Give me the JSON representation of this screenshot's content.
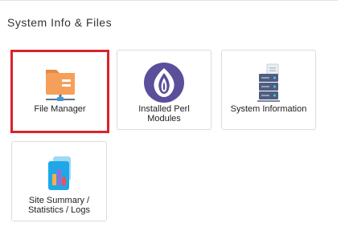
{
  "section": {
    "title": "System Info & Files"
  },
  "tiles": [
    {
      "label": "File Manager",
      "icon": "folder-network-icon",
      "selected": true
    },
    {
      "label": "Installed Perl Modules",
      "icon": "perl-onion-icon",
      "selected": false
    },
    {
      "label": "System Information",
      "icon": "server-rack-icon",
      "selected": false
    },
    {
      "label": "Site Summary / Statistics / Logs",
      "icon": "statistics-document-icon",
      "selected": false
    }
  ],
  "colors": {
    "selection_outline": "#d9232b",
    "folder_orange": "#f5a05a",
    "onion_purple": "#5b4f9b",
    "server_slate": "#4f5d7e",
    "stats_blue": "#1fa8e8"
  }
}
